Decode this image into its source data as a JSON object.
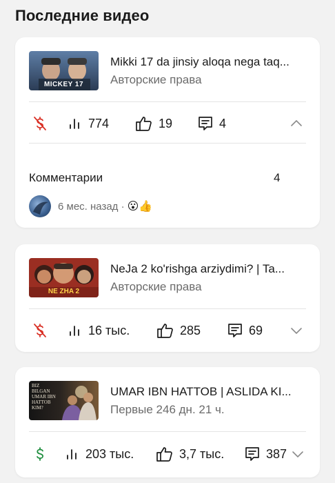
{
  "section": {
    "title": "Последние видео"
  },
  "colors": {
    "monetization_off": "#d93025",
    "monetization_on": "#1e8e3e",
    "text_secondary": "#6b6b6b"
  },
  "videos": [
    {
      "title": "Mikki 17 da jinsiy aloqa nega taq...",
      "status": "Авторские права",
      "thumbnail_text": "MICKEY 17",
      "monetization": "off",
      "views": "774",
      "likes": "19",
      "comments": "4",
      "expanded": true,
      "comments_section": {
        "label": "Комментарии",
        "count": "4",
        "latest_time": "6 мес. назад ·",
        "latest_emojis": "😮👍"
      }
    },
    {
      "title": "NeJa 2 ko'rishga arziydimi? | Ta...",
      "status": "Авторские права",
      "thumbnail_text": "NE ZHA 2",
      "monetization": "off",
      "views": "16 тыс.",
      "likes": "285",
      "comments": "69",
      "expanded": false
    },
    {
      "title": "UMAR IBN HATTOB | ASLIDA KI...",
      "status": "Первые 246 дн. 21 ч.",
      "thumbnail_text": "BIZ BILGAN UMAR IBN HATTOB KIM?",
      "monetization": "on",
      "views": "203 тыс.",
      "likes": "3,7 тыс.",
      "comments": "387",
      "expanded": false
    }
  ]
}
